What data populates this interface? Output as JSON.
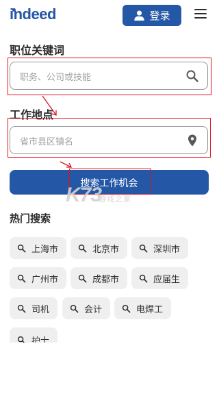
{
  "header": {
    "logo_text": "indeed",
    "login_label": "登录"
  },
  "keyword": {
    "label": "职位关键词",
    "placeholder": "职务、公司或技能"
  },
  "location": {
    "label": "工作地点",
    "placeholder": "省市县区镇名"
  },
  "search_button_label": "搜索工作机会",
  "hot_searches": {
    "title": "热门搜索",
    "items": [
      "上海市",
      "北京市",
      "深圳市",
      "广州市",
      "成都市",
      "应届生",
      "司机",
      "会计",
      "电焊工",
      "护士"
    ]
  },
  "watermark": {
    "text": "K73",
    "subtext": "游戏之家"
  },
  "colors": {
    "brand": "#2557a7",
    "annotation": "#e0101a",
    "chip_bg": "#efefef"
  }
}
